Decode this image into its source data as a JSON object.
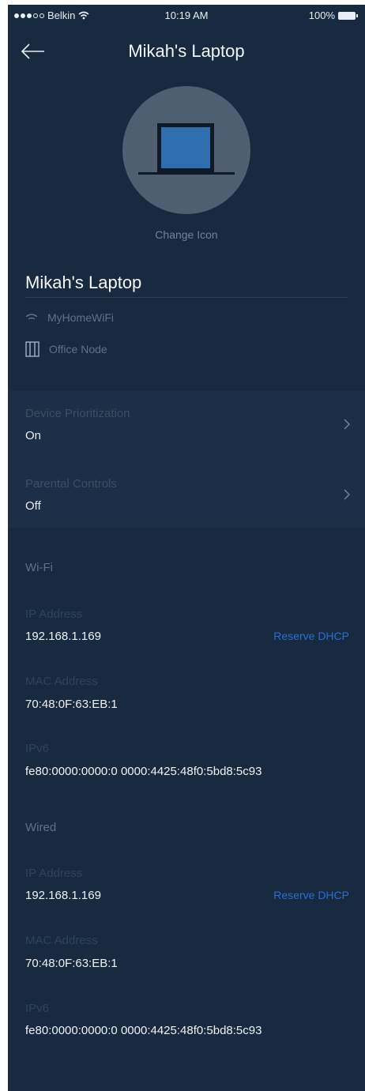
{
  "status_bar": {
    "carrier": "Belkin",
    "time": "10:19 AM",
    "battery": "100%"
  },
  "header": {
    "title": "Mikah's Laptop"
  },
  "device": {
    "change_icon_label": "Change Icon",
    "name": "Mikah's Laptop",
    "network": "MyHomeWiFi",
    "node": "Office Node"
  },
  "settings": [
    {
      "label": "Device Prioritization",
      "value": "On"
    },
    {
      "label": "Parental Controls",
      "value": "Off"
    }
  ],
  "wifi": {
    "title": "Wi-Fi",
    "ip_label": "IP Address",
    "ip_value": "192.168.1.169",
    "reserve_label": "Reserve DHCP",
    "mac_label": "MAC Address",
    "mac_value": "70:48:0F:63:EB:1",
    "ipv6_label": "IPv6",
    "ipv6_value": "fe80:0000:0000:0 0000:4425:48f0:5bd8:5c93"
  },
  "wired": {
    "title": "Wired",
    "ip_label": "IP Address",
    "ip_value": "192.168.1.169",
    "reserve_label": "Reserve DHCP",
    "mac_label": "MAC Address",
    "mac_value": "70:48:0F:63:EB:1",
    "ipv6_label": "IPv6",
    "ipv6_value": "fe80:0000:0000:0 0000:4425:48f0:5bd8:5c93"
  },
  "colors": {
    "background": "#172a40",
    "section_bg": "#1b3048",
    "link": "#2b6ed0",
    "avatar_circle": "#4e5f72",
    "laptop_screen": "#2f6fb0"
  },
  "icons": {
    "back": "arrow-left-icon",
    "wifi": "wifi-icon",
    "node": "node-icon",
    "chevron": "chevron-right-icon",
    "laptop": "laptop-icon"
  }
}
